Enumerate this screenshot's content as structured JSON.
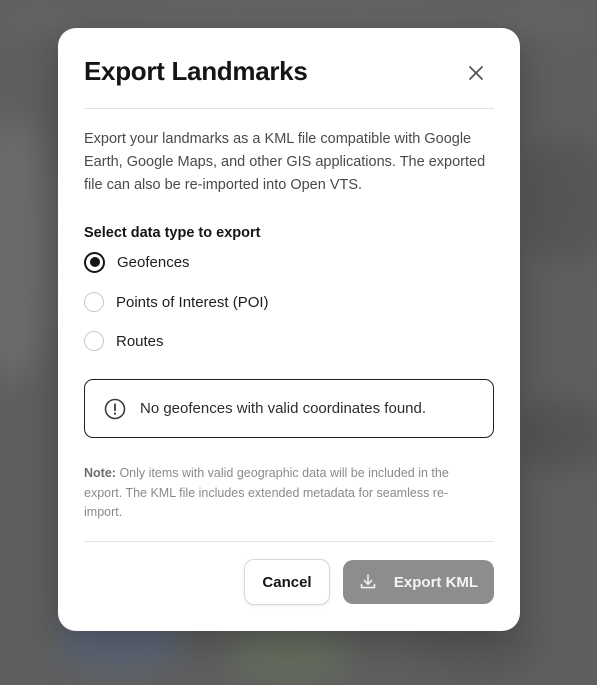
{
  "dialog": {
    "title": "Export Landmarks",
    "description": "Export your landmarks as a KML file compatible with Google Earth, Google Maps, and other GIS applications. The exported file can also be re-imported into Open VTS.",
    "section_label": "Select data type to export",
    "options": [
      {
        "label": "Geofences",
        "selected": true
      },
      {
        "label": "Points of Interest (POI)",
        "selected": false
      },
      {
        "label": "Routes",
        "selected": false
      }
    ],
    "alert": {
      "icon": "exclamation-circle-icon",
      "text": "No geofences with valid coordinates found."
    },
    "note": {
      "label": "Note:",
      "text": "Only items with valid geographic data will be included in the export. The KML file includes extended metadata for seamless re-import."
    },
    "buttons": {
      "cancel": "Cancel",
      "export": "Export KML"
    }
  },
  "colors": {
    "backdrop": "#5f5f5f",
    "primary_text": "#151515",
    "export_button_disabled": "#8d8d8d"
  }
}
